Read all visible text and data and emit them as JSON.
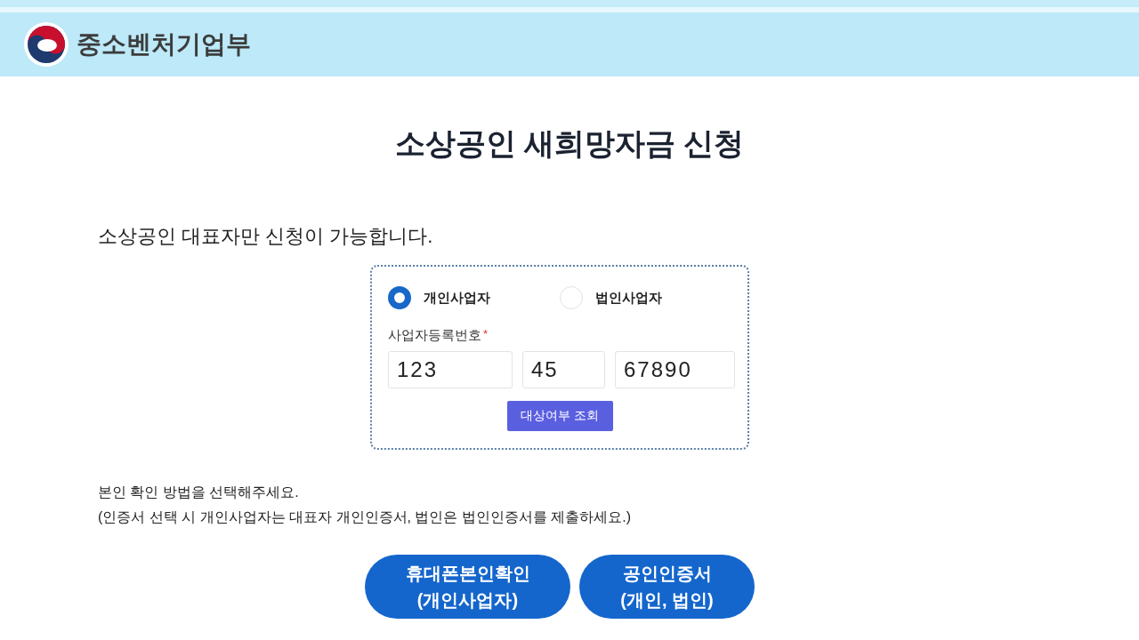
{
  "header": {
    "ministry": "중소벤처기업부"
  },
  "title": "소상공인 새희망자금 신청",
  "notice": "소상공인 대표자만 신청이 가능합니다.",
  "business_types": [
    {
      "label": "개인사업자",
      "selected": true
    },
    {
      "label": "법인사업자",
      "selected": false
    }
  ],
  "registration": {
    "label": "사업자등록번호",
    "required_mark": "*",
    "parts": [
      "123",
      "45",
      "67890"
    ]
  },
  "check_button": "대상여부 조회",
  "instructions": [
    "본인 확인 방법을 선택해주세요.",
    "(인증서 선택 시 개인사업자는 대표자 개인인증서, 법인은 법인인증서를 제출하세요.)"
  ],
  "auth_buttons": [
    [
      "휴대폰본인확인",
      "(개인사업자)"
    ],
    [
      "공인인증서",
      "(개인, 법인)"
    ]
  ]
}
